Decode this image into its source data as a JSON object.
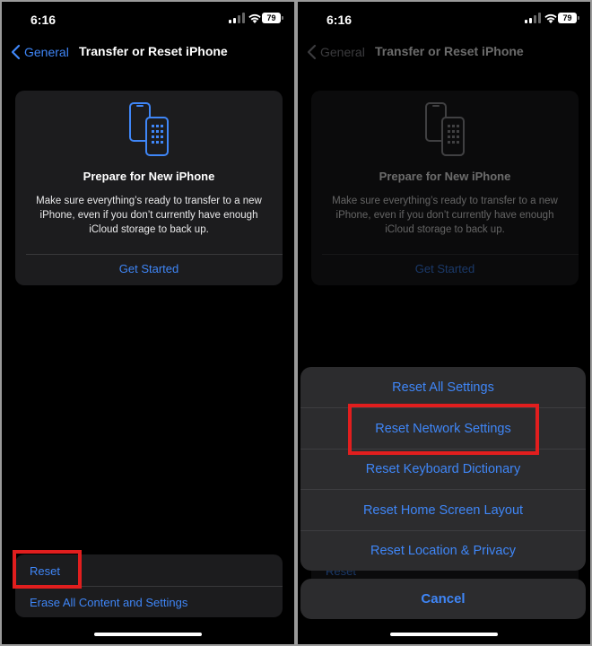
{
  "status": {
    "time": "6:16",
    "battery": "79"
  },
  "nav": {
    "back_label": "General",
    "title": "Transfer or Reset iPhone"
  },
  "card": {
    "title": "Prepare for New iPhone",
    "description": "Make sure everything’s ready to transfer to a new iPhone, even if you don’t currently have enough iCloud storage to back up.",
    "action": "Get Started"
  },
  "reset_group": {
    "reset_label": "Reset",
    "erase_label": "Erase All Content and Settings"
  },
  "sheet": {
    "items": [
      "Reset All Settings",
      "Reset Network Settings",
      "Reset Keyboard Dictionary",
      "Reset Home Screen Layout",
      "Reset Location & Privacy"
    ],
    "cancel": "Cancel"
  },
  "colors": {
    "accent": "#3f86f7",
    "highlight": "#e11e1e",
    "card_bg": "#1c1c1e",
    "sheet_bg": "#2c2c2e"
  }
}
